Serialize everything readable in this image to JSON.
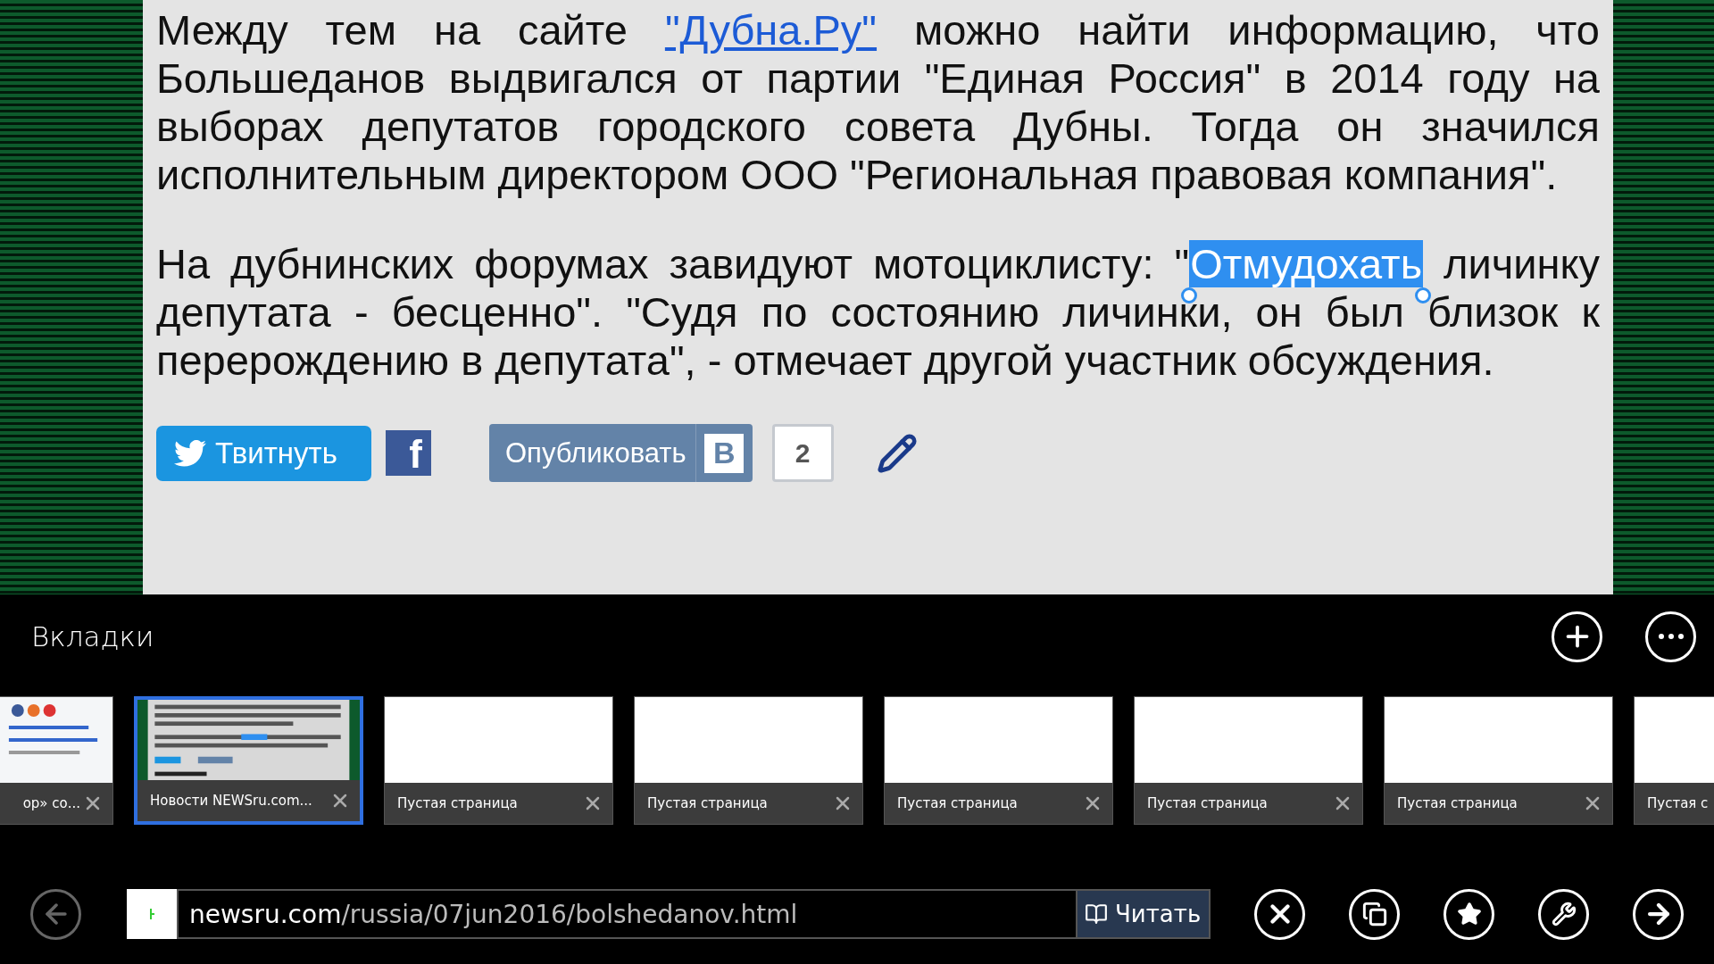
{
  "article": {
    "paragraph_1": {
      "before": "Между тем на сайте ",
      "link": "\"Дубна.Ру\"",
      "after": " можно найти информацию, что Большеданов выдвигался от партии \"Единая Россия\" в 2014 году на выборах депутатов городского совета Дубны. Тогда он значился исполнительным директором ООО \"Региональная правовая компания\"."
    },
    "paragraph_2": {
      "before": "На дубнинских форумах завидуют мотоциклисту: \"",
      "selection": "Отмудохать",
      "after": " личинку депутата - бесценно\". \"Судя по состоянию личинки, он был близок к перерождению в депутата\", - отмечает другой участник обсуждения."
    }
  },
  "share": {
    "tweet": "Твитнуть",
    "facebook": "f",
    "publish": "Опубликовать",
    "vk": "В",
    "count": "2"
  },
  "tabs_panel": {
    "title": "Вкладки",
    "tabs": [
      {
        "title": "ор» со...",
        "selected": false,
        "kind": "page"
      },
      {
        "title": "Новости NEWSru.com...",
        "selected": true,
        "kind": "page"
      },
      {
        "title": "Пустая страница",
        "selected": false,
        "kind": "blank"
      },
      {
        "title": "Пустая страница",
        "selected": false,
        "kind": "blank"
      },
      {
        "title": "Пустая страница",
        "selected": false,
        "kind": "blank"
      },
      {
        "title": "Пустая страница",
        "selected": false,
        "kind": "blank"
      },
      {
        "title": "Пустая страница",
        "selected": false,
        "kind": "blank"
      },
      {
        "title": "Пустая с",
        "selected": false,
        "kind": "blank"
      }
    ]
  },
  "address_bar": {
    "back_disabled": true,
    "domain": "newsru.com",
    "path": "/russia/07jun2016/bolshedanov.html",
    "read": "Читать"
  }
}
